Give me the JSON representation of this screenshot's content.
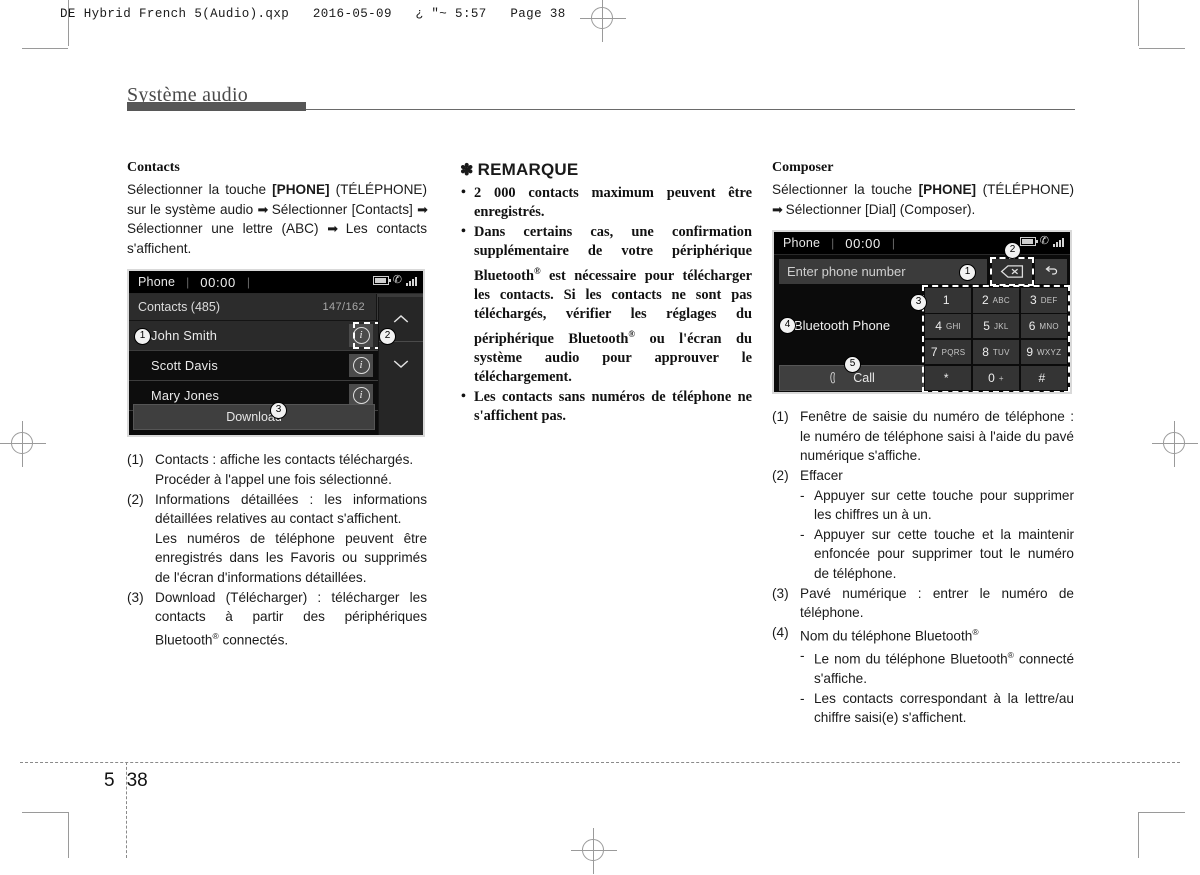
{
  "doc": {
    "header_line": "DE Hybrid French 5(Audio).qxp   2016-05-09   ¿ \"~ 5:57   Page 38",
    "chapter_title": "Système audio",
    "folio_chapter": "5",
    "folio_page": "38"
  },
  "left": {
    "heading": "Contacts",
    "intro_1": "Sélectionner la touche ",
    "intro_bold": "[PHONE]",
    "intro_2": " (TÉLÉPHONE) sur le système audio ",
    "intro_3": " Sélectionner [Contacts] ",
    "intro_4": " Sélectionner une lettre (ABC) ",
    "intro_5": " Les contacts s'affichent.",
    "items": [
      {
        "marker": "(1)",
        "text": "Contacts : affiche les contacts téléchargés.",
        "cont": "Procéder à l'appel une fois sélectionné."
      },
      {
        "marker": "(2)",
        "text": "Informations détaillées : les informations détaillées relatives au contact s'affichent.",
        "cont": "Les numéros de téléphone peuvent être enregistrés dans les Favoris ou supprimés de l'écran d'informations détaillées."
      },
      {
        "marker": "(3)",
        "text_a": "Download (Télécharger) : télécharger les contacts à partir des périphériques Bluetooth",
        "text_b": " connectés."
      }
    ]
  },
  "contacts_screen": {
    "status_title": "Phone",
    "clock": "00:00",
    "list_title": "Contacts (485)",
    "list_count": "147/162",
    "rows": [
      {
        "name": "John Smith",
        "selected": true
      },
      {
        "name": "Scott Davis",
        "selected": false
      },
      {
        "name": "Mary Jones",
        "selected": false
      }
    ],
    "download_label": "Download",
    "callouts": [
      "1",
      "2",
      "3"
    ]
  },
  "middle": {
    "note_star": "✽",
    "note_title": "REMARQUE",
    "bullets": [
      {
        "text": "2 000 contacts maximum peuvent être enregistrés."
      },
      {
        "a": "Dans certains cas, une confirmation supplémentaire de votre périphérique Bluetooth",
        "b": " est nécessaire pour télécharger les contacts. Si les contacts ne sont pas téléchargés, vérifier les réglages du périphérique Bluetooth",
        "c": " ou l'écran du système audio pour approuver le téléchargement."
      },
      {
        "text": "Les contacts sans numéros de téléphone ne s'affichent pas."
      }
    ]
  },
  "right": {
    "heading": "Composer",
    "intro_1": "Sélectionner la touche ",
    "intro_bold": "[PHONE]",
    "intro_2": " (TÉLÉPHONE) ",
    "intro_3": " Sélectionner [Dial] (Composer).",
    "items": [
      {
        "marker": "(1)",
        "text": "Fenêtre de saisie du numéro de téléphone : le numéro de téléphone saisi à l'aide du pavé numérique s'affiche."
      },
      {
        "marker": "(2)",
        "text": "Effacer",
        "subs": [
          "Appuyer sur cette touche pour supprimer les chiffres un à un.",
          "Appuyer sur cette touche et la maintenir enfoncée pour supprimer tout le numéro de téléphone."
        ]
      },
      {
        "marker": "(3)",
        "text": "Pavé numérique : entrer le numéro de téléphone."
      },
      {
        "marker": "(4)",
        "text_a": "Nom du téléphone Bluetooth",
        "subs_rich": [
          {
            "a": "Le nom du téléphone Bluetooth",
            "b": " connecté s'affiche."
          },
          {
            "a": "Les contacts correspondant à la lettre/au chiffre saisi(e) s'affichent.",
            "b": ""
          }
        ]
      }
    ]
  },
  "dial_screen": {
    "status_title": "Phone",
    "clock": "00:00",
    "input_placeholder": "Enter phone number",
    "bt_name": "Bluetooth Phone",
    "call_label": "Call",
    "keys": [
      {
        "digit": "1",
        "letters": ""
      },
      {
        "digit": "2",
        "letters": "ABC"
      },
      {
        "digit": "3",
        "letters": "DEF"
      },
      {
        "digit": "4",
        "letters": "GHI"
      },
      {
        "digit": "5",
        "letters": "JKL"
      },
      {
        "digit": "6",
        "letters": "MNO"
      },
      {
        "digit": "7",
        "letters": "PQRS"
      },
      {
        "digit": "8",
        "letters": "TUV"
      },
      {
        "digit": "9",
        "letters": "WXYZ"
      },
      {
        "digit": "*",
        "letters": ""
      },
      {
        "digit": "0",
        "letters": "+"
      },
      {
        "digit": "#",
        "letters": ""
      }
    ],
    "callouts": [
      "1",
      "2",
      "3",
      "4",
      "5"
    ]
  },
  "colors": {
    "rule": "#575757",
    "title": "#4a4a4a",
    "screen_bg": "#0b0b0b"
  }
}
